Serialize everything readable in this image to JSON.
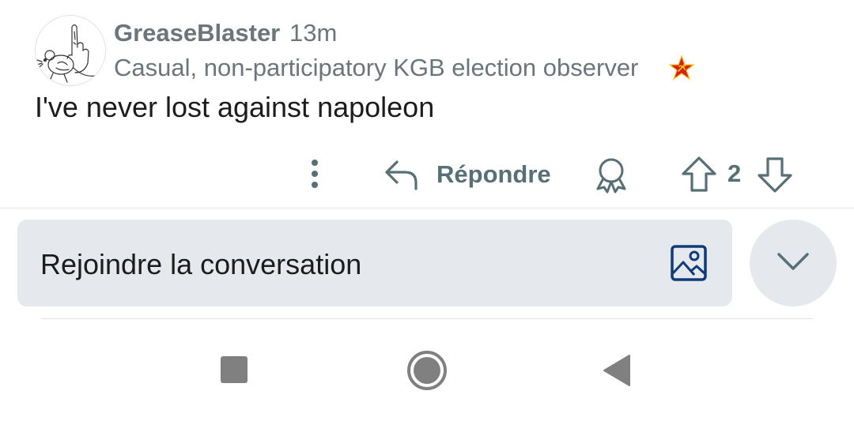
{
  "comment": {
    "username": "GreaseBlaster",
    "timestamp": "13m",
    "flair": "Casual, non-participatory KGB election observer",
    "body": "I've never lost against napoleon"
  },
  "actions": {
    "reply_label": "Répondre",
    "vote_count": "2"
  },
  "composer": {
    "placeholder": "Rejoindre la conversation"
  },
  "icons": {
    "avatar": "avatar-mouse-drawing",
    "flair_emoji": "star-hammer-sickle-icon",
    "more": "more-vertical-icon",
    "reply": "reply-arrow-icon",
    "award": "award-icon",
    "upvote": "upvote-arrow-icon",
    "downvote": "downvote-arrow-icon",
    "image": "image-icon",
    "collapse": "chevron-down-icon",
    "nav_recent": "square-icon",
    "nav_home": "circle-icon",
    "nav_back": "triangle-back-icon"
  },
  "colors": {
    "meta_text": "#6b757b",
    "action_text": "#576f76",
    "composer_bg": "#e5e9ee",
    "image_icon": "#0f3c78",
    "body_text": "#1c1c1c"
  }
}
